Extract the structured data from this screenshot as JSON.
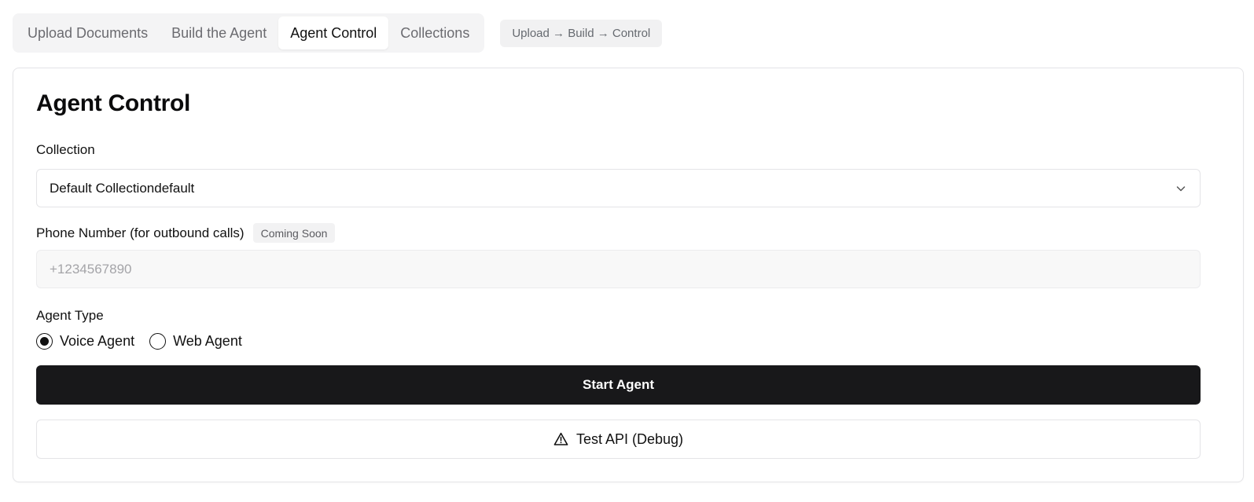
{
  "tabs": [
    {
      "label": "Upload Documents",
      "active": false
    },
    {
      "label": "Build the Agent",
      "active": false
    },
    {
      "label": "Agent Control",
      "active": true
    },
    {
      "label": "Collections",
      "active": false
    }
  ],
  "flow_hint": "Upload → Build → Control",
  "card": {
    "title": "Agent Control",
    "collection": {
      "label": "Collection",
      "selected": "Default Collectiondefault",
      "icon": "chevron-down-icon"
    },
    "phone": {
      "label": "Phone Number (for outbound calls)",
      "badge": "Coming Soon",
      "placeholder": "+1234567890",
      "value": ""
    },
    "agent_type": {
      "label": "Agent Type",
      "options": [
        {
          "label": "Voice Agent",
          "selected": true
        },
        {
          "label": "Web Agent",
          "selected": false
        }
      ]
    },
    "start_button": "Start Agent",
    "debug_button": {
      "label": "Test API (Debug)",
      "icon": "warning-triangle-icon"
    }
  },
  "colors": {
    "primary_button": "#18181a",
    "tab_bg": "#f4f4f5",
    "border": "#e4e4e7"
  }
}
